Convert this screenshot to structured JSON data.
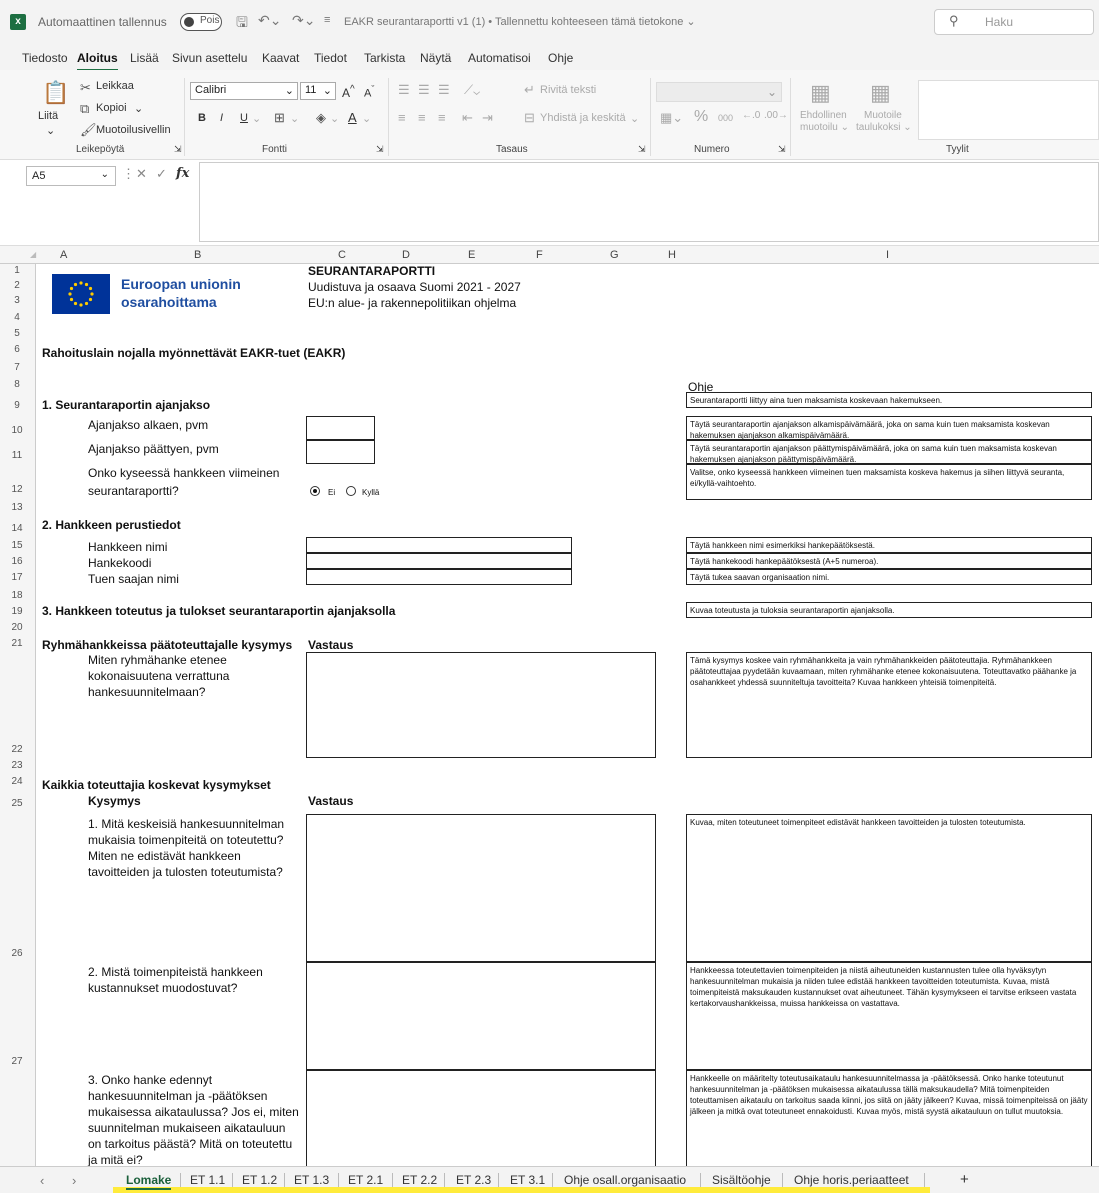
{
  "window": {
    "autosave_label": "Automaattinen tallennus",
    "autosave_state": "Pois",
    "document_title": "EAKR seurantaraportti v1 (1) • Tallennettu kohteeseen tämä tietokone ⌄",
    "search_placeholder": "Haku"
  },
  "menu_tabs": [
    "Tiedosto",
    "Aloitus",
    "Lisää",
    "Sivun asettelu",
    "Kaavat",
    "Tiedot",
    "Tarkista",
    "Näytä",
    "Automatisoi",
    "Ohje"
  ],
  "active_menu_tab": "Aloitus",
  "ribbon": {
    "clipboard": {
      "paste": "Liitä",
      "cut": "Leikkaa",
      "copy": "Kopioi",
      "format_painter": "Muotoilusivellin",
      "label": "Leikepöytä"
    },
    "font": {
      "name": "Calibri",
      "size": "11",
      "bold": "B",
      "italic": "I",
      "underline": "U",
      "label": "Fontti"
    },
    "alignment": {
      "wrap_text": "Rivitä teksti",
      "merge_center": "Yhdistä ja keskitä",
      "label": "Tasaus"
    },
    "number": {
      "percent": "%",
      "thousands": "000",
      "label": "Numero"
    },
    "styles": {
      "conditional": "Ehdollinen muotoilu ⌄",
      "conditional_1": "Ehdollinen",
      "conditional_2": "muotoilu ⌄",
      "format_table_1": "Muotoile",
      "format_table_2": "taulukoksi ⌄",
      "label": "Tyylit"
    }
  },
  "formula_bar": {
    "name_box": "A5",
    "fx": "fx"
  },
  "columns": [
    "A",
    "B",
    "C",
    "D",
    "E",
    "F",
    "G",
    "H",
    "I"
  ],
  "rows": [
    "1",
    "2",
    "3",
    "4",
    "5",
    "6",
    "7",
    "8",
    "9",
    "10",
    "11",
    "12",
    "13",
    "14",
    "15",
    "16",
    "17",
    "18",
    "19",
    "20",
    "21",
    "22",
    "23",
    "24",
    "25",
    "26",
    "27"
  ],
  "sheet": {
    "eu_line1": "Euroopan unionin",
    "eu_line2": "osarahoittama",
    "report_title": "SEURANTARAPORTTI",
    "program_line1": "Uudistuva ja osaava Suomi 2021 - 2027",
    "program_line2": "EU:n alue- ja rakennepolitiikan ohjelma",
    "main_heading": "Rahoituslain nojalla myönnettävät EAKR-tuet (EAKR)",
    "help_heading": "Ohje",
    "section1": "1. Seurantaraportin ajanjakso",
    "period_start": "Ajanjakso alkaen, pvm",
    "period_end": "Ajanjakso päättyen, pvm",
    "last_report_q1": "Onko kyseessä hankkeen viimeinen",
    "last_report_q2": "seurantaraportti?",
    "radio_no": "Ei",
    "radio_yes": "Kyllä",
    "section2": "2. Hankkeen perustiedot",
    "project_name": "Hankkeen nimi",
    "project_code": "Hankekoodi",
    "recipient_name": "Tuen saajan nimi",
    "section3": "3. Hankkeen toteutus ja tulokset seurantaraportin ajanjaksolla",
    "group_heading": "Ryhmähankkeissa päätoteuttajalle kysymys",
    "answer_heading": "Vastaus",
    "group_question": "Miten ryhmähanke etenee kokonaisuutena verrattuna hankesuunnitelmaan?",
    "all_heading": "Kaikkia toteuttajia koskevat kysymykset",
    "question_heading": "Kysymys",
    "answer_heading2": "Vastaus",
    "q1": "1. Mitä keskeisiä hankesuunnitelman mukaisia toimenpiteitä on toteutettu? Miten ne edistävät hankkeen tavoitteiden ja tulosten toteutumista?",
    "q2": "2. Mistä toimenpiteistä hankkeen kustannukset muodostuvat?",
    "q3": "3. Onko hanke edennyt hankesuunnitelman ja -päätöksen mukaisessa aikataulussa? Jos ei, miten suunnitelman mukaiseen aikatauluun on tarkoitus päästä? Mitä on toteutettu ja mitä ei?"
  },
  "help": {
    "h9": "Seurantaraportti liittyy aina tuen maksamista koskevaan hakemukseen.",
    "h10": "Täytä seurantaraportin ajanjakson alkamispäivämäärä, joka on sama kuin tuen maksamista koskevan hakemuksen ajanjakson alkamispäivämäärä.",
    "h11": "Täytä seurantaraportin ajanjakson päättymispäivämäärä, joka on sama kuin tuen maksamista koskevan hakemuksen ajanjakson päättymispäivämäärä.",
    "h12": "Valitse, onko kyseessä hankkeen viimeinen tuen maksamista koskeva hakemus ja siihen liittyvä seuranta, ei/kyllä-vaihtoehto.",
    "h15": "Täytä hankkeen nimi esimerkiksi hankepäätöksestä.",
    "h16": "Täytä hankekoodi hankepäätöksestä (A+5 numeroa).",
    "h17": "Täytä tukea saavan organisaation nimi.",
    "h19": "Kuvaa toteutusta ja tuloksia seurantaraportin ajanjaksolla.",
    "h22": "Tämä kysymys koskee vain ryhmähankkeita ja vain ryhmähankkeiden päätoteuttajia. Ryhmähankkeen päätoteuttajaa pyydetään kuvaamaan, miten ryhmähanke etenee kokonaisuutena. Toteuttavatko päähanke ja osahankkeet yhdessä suunniteltuja tavoitteita? Kuvaa hankkeen yhteisiä toimenpiteitä.",
    "h26": "Kuvaa, miten toteutuneet toimenpiteet edistävät hankkeen tavoitteiden ja tulosten toteutumista.",
    "h27": "Hankkeessa toteutettavien toimenpiteiden ja niistä aiheutuneiden kustannusten tulee olla hyväksytyn hankesuunnitelman mukaisia ja niiden tulee edistää hankkeen tavoitteiden toteutumista. Kuvaa, mistä toimenpiteistä maksukauden kustannukset ovat aiheutuneet. Tähän kysymykseen ei tarvitse erikseen vastata kertakorvaushankkeissa, muissa hankkeissa on vastattava.",
    "h28": "Hankkeelle on määritelty toteutusaikataulu hankesuunnitelmassa ja -päätöksessä. Onko hanke toteutunut hankesuunnitelman ja -päätöksen mukaisessa aikataulussa tällä maksukaudella? Mitä toimenpiteiden toteuttamisen aikataulu on tarkoitus saada kiinni, jos siitä on jääty jälkeen? Kuvaa, missä toimenpiteissä on jääty jälkeen ja mitkä ovat toteutuneet ennakoidusti. Kuvaa myös, mistä syystä aikatauluun on tullut muutoksia."
  },
  "sheet_tabs": [
    "Lomake",
    "ET 1.1",
    "ET 1.2",
    "ET 1.3",
    "ET 2.1",
    "ET 2.2",
    "ET 2.3",
    "ET 3.1",
    "Ohje osall.organisaatio",
    "Sisältöohje",
    "Ohje horis.periaatteet"
  ],
  "active_sheet_tab": "Lomake",
  "add_sheet": "+",
  "colors": {
    "excel_green": "#1d6f42",
    "eu_blue": "#003399",
    "eu_text": "#1f4ea0",
    "tab_highlight": "#ffeb3b"
  }
}
